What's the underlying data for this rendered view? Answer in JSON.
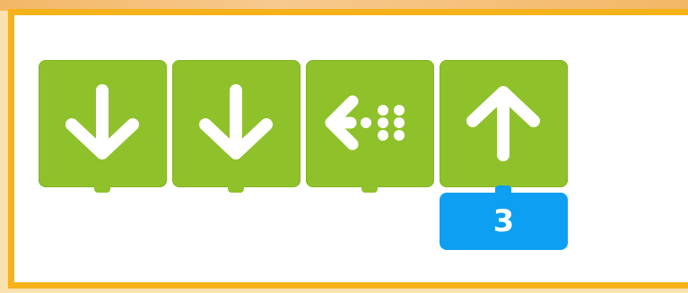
{
  "blocks": [
    {
      "icon": "arrow-down-icon"
    },
    {
      "icon": "arrow-down-icon"
    },
    {
      "icon": "arrow-left-dots-icon"
    },
    {
      "icon": "arrow-up-icon"
    }
  ],
  "repeat_badge": {
    "value": "3"
  },
  "colors": {
    "block": "#8fc12a",
    "badge": "#0d9ff1",
    "border": "#f6b21b",
    "icon": "#ffffff"
  }
}
